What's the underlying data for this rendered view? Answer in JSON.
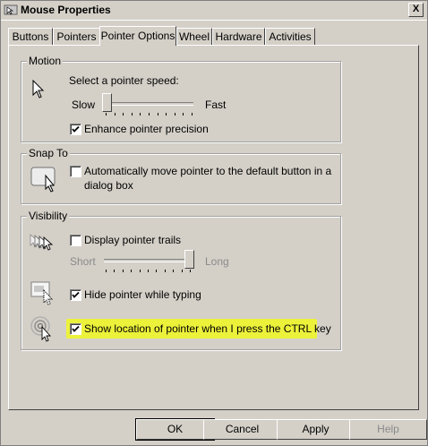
{
  "window": {
    "title": "Mouse Properties",
    "close_glyph": "X"
  },
  "tabs": [
    {
      "label": "Buttons",
      "active": false
    },
    {
      "label": "Pointers",
      "active": false
    },
    {
      "label": "Pointer Options",
      "active": true
    },
    {
      "label": "Wheel",
      "active": false
    },
    {
      "label": "Hardware",
      "active": false
    },
    {
      "label": "Activities",
      "active": false
    }
  ],
  "motion": {
    "group_label": "Motion",
    "speed_label": "Select a pointer speed:",
    "slow_label": "Slow",
    "fast_label": "Fast",
    "speed_value": 0.0,
    "enhance_label": "Enhance pointer precision",
    "enhance_checked": true
  },
  "snapto": {
    "group_label": "Snap To",
    "auto_label_line1": "Automatically move pointer to the default button in a",
    "auto_label_line2": "dialog box",
    "auto_checked": false
  },
  "visibility": {
    "group_label": "Visibility",
    "trails_label": "Display pointer trails",
    "trails_checked": false,
    "short_label": "Short",
    "long_label": "Long",
    "trails_value": 1.0,
    "hide_label": "Hide pointer while typing",
    "hide_checked": true,
    "show_location_label": "Show location of pointer when I press the CTRL key",
    "show_location_checked": true
  },
  "buttons": {
    "ok": "OK",
    "cancel": "Cancel",
    "apply": "Apply",
    "help": "Help"
  },
  "colors": {
    "highlight": "#ecf23a",
    "dialog_bg": "#d4d0c8"
  }
}
